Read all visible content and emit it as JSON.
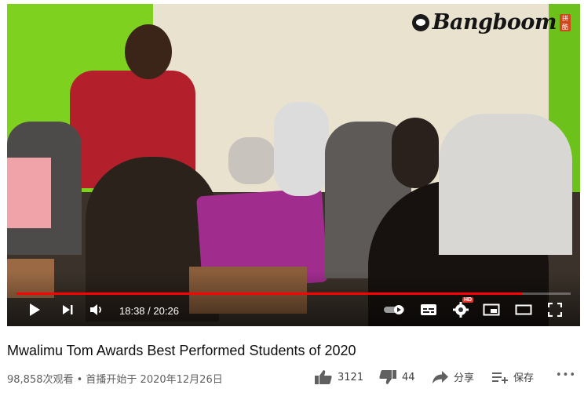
{
  "brand": {
    "name": "Bangboom",
    "seal_text": "拼 酷"
  },
  "player": {
    "current_time": "18:38",
    "duration": "20:26",
    "progress": 0.912,
    "hd_badge": "HD"
  },
  "video": {
    "title": "Mwalimu Tom Awards Best Performed Students of 2020",
    "meta": "98,858次观看 • 首播开始于 2020年12月26日"
  },
  "actions": {
    "likes": "3121",
    "dislikes": "44",
    "share_label": "分享",
    "save_label": "保存",
    "more_label": "•••"
  },
  "colors": {
    "progress": "#ff0000",
    "hd_badge": "#e4372b"
  }
}
